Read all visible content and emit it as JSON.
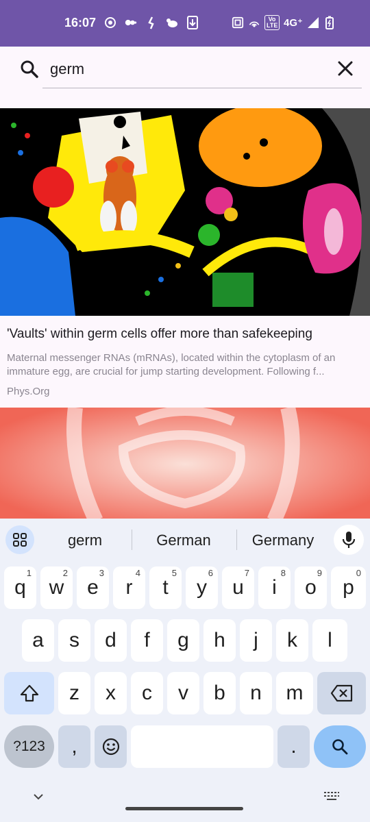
{
  "status_bar": {
    "time": "16:07",
    "network": "4G⁺",
    "volte": "Vo LTE",
    "background_color": "#6f55a8"
  },
  "search": {
    "query": "germ",
    "icon": "search-icon",
    "clear_icon": "close-icon"
  },
  "articles": [
    {
      "title": "'Vaults' within germ cells offer more than safekeeping",
      "summary": "Maternal messenger RNAs (mRNAs), located within the cytoplasm of an immature egg, are crucial for jump starting development. Following f...",
      "source": "Phys.Org"
    }
  ],
  "keyboard": {
    "suggestions": [
      "germ",
      "German",
      "Germany"
    ],
    "row1": [
      {
        "key": "q",
        "hint": "1"
      },
      {
        "key": "w",
        "hint": "2"
      },
      {
        "key": "e",
        "hint": "3"
      },
      {
        "key": "r",
        "hint": "4"
      },
      {
        "key": "t",
        "hint": "5"
      },
      {
        "key": "y",
        "hint": "6"
      },
      {
        "key": "u",
        "hint": "7"
      },
      {
        "key": "i",
        "hint": "8"
      },
      {
        "key": "o",
        "hint": "9"
      },
      {
        "key": "p",
        "hint": "0"
      }
    ],
    "row2": [
      "a",
      "s",
      "d",
      "f",
      "g",
      "h",
      "j",
      "k",
      "l"
    ],
    "row3": [
      "z",
      "x",
      "c",
      "v",
      "b",
      "n",
      "m"
    ],
    "num_label": "?123",
    "comma": ",",
    "period": ".",
    "accent_color": "#8fc2f7"
  }
}
